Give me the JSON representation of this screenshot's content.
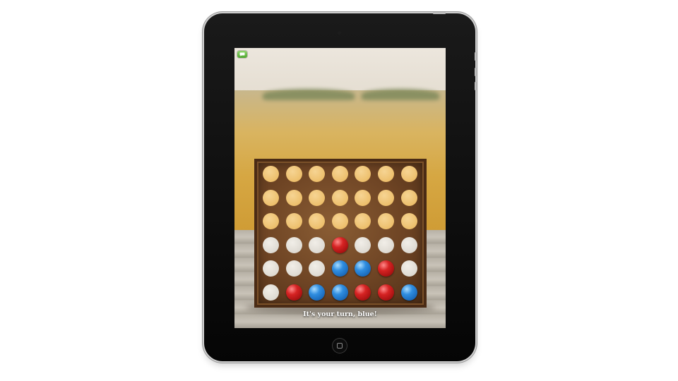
{
  "status": {
    "message": "It's your turn, blue!"
  },
  "message_button": {
    "icon": "chat-bubble-icon",
    "color": "#5cb83a"
  },
  "board": {
    "rows": 6,
    "columns": 7,
    "cells": [
      [
        "empty",
        "empty",
        "empty",
        "empty",
        "empty",
        "empty",
        "empty"
      ],
      [
        "empty",
        "empty",
        "empty",
        "empty",
        "empty",
        "empty",
        "empty"
      ],
      [
        "empty",
        "empty",
        "empty",
        "empty",
        "empty",
        "empty",
        "empty"
      ],
      [
        "empty",
        "empty",
        "empty",
        "red",
        "empty",
        "empty",
        "empty"
      ],
      [
        "empty",
        "empty",
        "empty",
        "blue",
        "blue",
        "red",
        "empty"
      ],
      [
        "empty",
        "red",
        "blue",
        "blue",
        "red",
        "red",
        "blue"
      ]
    ],
    "colors": {
      "red": "#d62323",
      "blue": "#2f8de0",
      "wood": "#6e4424"
    }
  }
}
